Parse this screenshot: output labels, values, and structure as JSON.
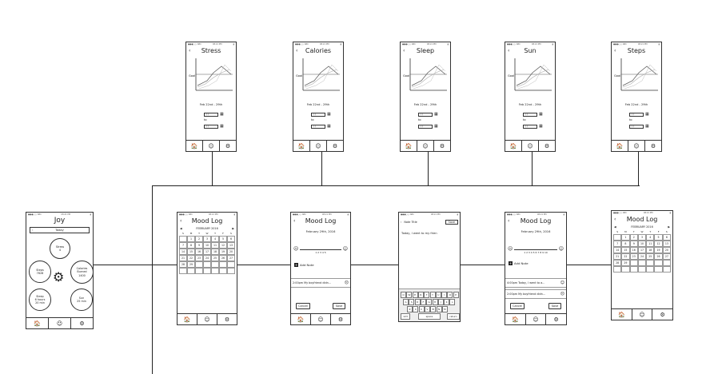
{
  "status": {
    "carrier": "●●●○○ ABC",
    "time": "08:21 PM"
  },
  "nav": {
    "home": "🏠",
    "mood": "☺",
    "settings": "⚙"
  },
  "metric_screens": [
    {
      "title": "Stress",
      "goal": "Goal",
      "date_range": "Feb 22nd - 29th",
      "date_placeholder": "/ /",
      "to": "to"
    },
    {
      "title": "Calories",
      "goal": "Goal",
      "date_range": "Feb 22nd - 29th",
      "date_placeholder": "/ /",
      "to": "to"
    },
    {
      "title": "Sleep",
      "goal": "Goal",
      "date_range": "Feb 22nd - 29th",
      "date_placeholder": "/ /",
      "to": "to"
    },
    {
      "title": "Sun",
      "goal": "Goal",
      "date_range": "Feb 22nd - 29th",
      "date_placeholder": "/ /",
      "to": "to"
    },
    {
      "title": "Steps",
      "goal": "Goal",
      "date_range": "Feb 22nd - 29th",
      "date_placeholder": "/ /",
      "to": "to"
    }
  ],
  "home": {
    "title": "Joy",
    "today": "Today",
    "stress": "Stress\n4",
    "steps": "Steps\n7628",
    "calories": "Calories\nBurned\n1400",
    "sleep": "Sleep\n6 hours\n20 min",
    "sun": "Sun\n25 min"
  },
  "calendar": {
    "title": "Mood Log",
    "month": "FEBRUARY 2016",
    "days": [
      "S",
      "M",
      "T",
      "W",
      "T",
      "F",
      "S"
    ],
    "cells": [
      "",
      "1",
      "2",
      "3",
      "4",
      "5",
      "6",
      "7",
      "8",
      "9",
      "10",
      "11",
      "12",
      "13",
      "14",
      "15",
      "16",
      "17",
      "18",
      "19",
      "20",
      "21",
      "22",
      "23",
      "24",
      "25",
      "26",
      "27",
      "28",
      "29",
      "",
      "",
      "",
      "",
      "",
      "",
      "",
      "",
      "",
      "",
      "",
      ""
    ]
  },
  "entry": {
    "title": "Mood Log",
    "date": "February 29th, 2016",
    "scale": "1   2   3   4   5",
    "add_note": "Add Note",
    "log_time": "2:00pm",
    "log_text": "My boyfriend didn...",
    "cancel": "Cancel",
    "save": "Save"
  },
  "note": {
    "title": "Note Title",
    "save": "Save",
    "text": "Today, I went to my frien",
    "rows": [
      "QWERTYUIOP",
      "ASDFGHJKL",
      "ZXCVBNM"
    ],
    "space": "space",
    "return": "return",
    "num": "123"
  },
  "entry2": {
    "title": "Mood Log",
    "date": "February 29th, 2016",
    "scale": "1 2 3 4 5 6 7 8 9 10",
    "add_note": "Add Note",
    "log1_time": "4:00pm",
    "log1_text": "Today, I went to a...",
    "log2_time": "2:00pm",
    "log2_text": "My boyfriend didn...",
    "cancel": "Cancel",
    "save": "Save"
  },
  "calendar2": {
    "title": "Mood Log",
    "month": "FEBRUARY 2016"
  }
}
